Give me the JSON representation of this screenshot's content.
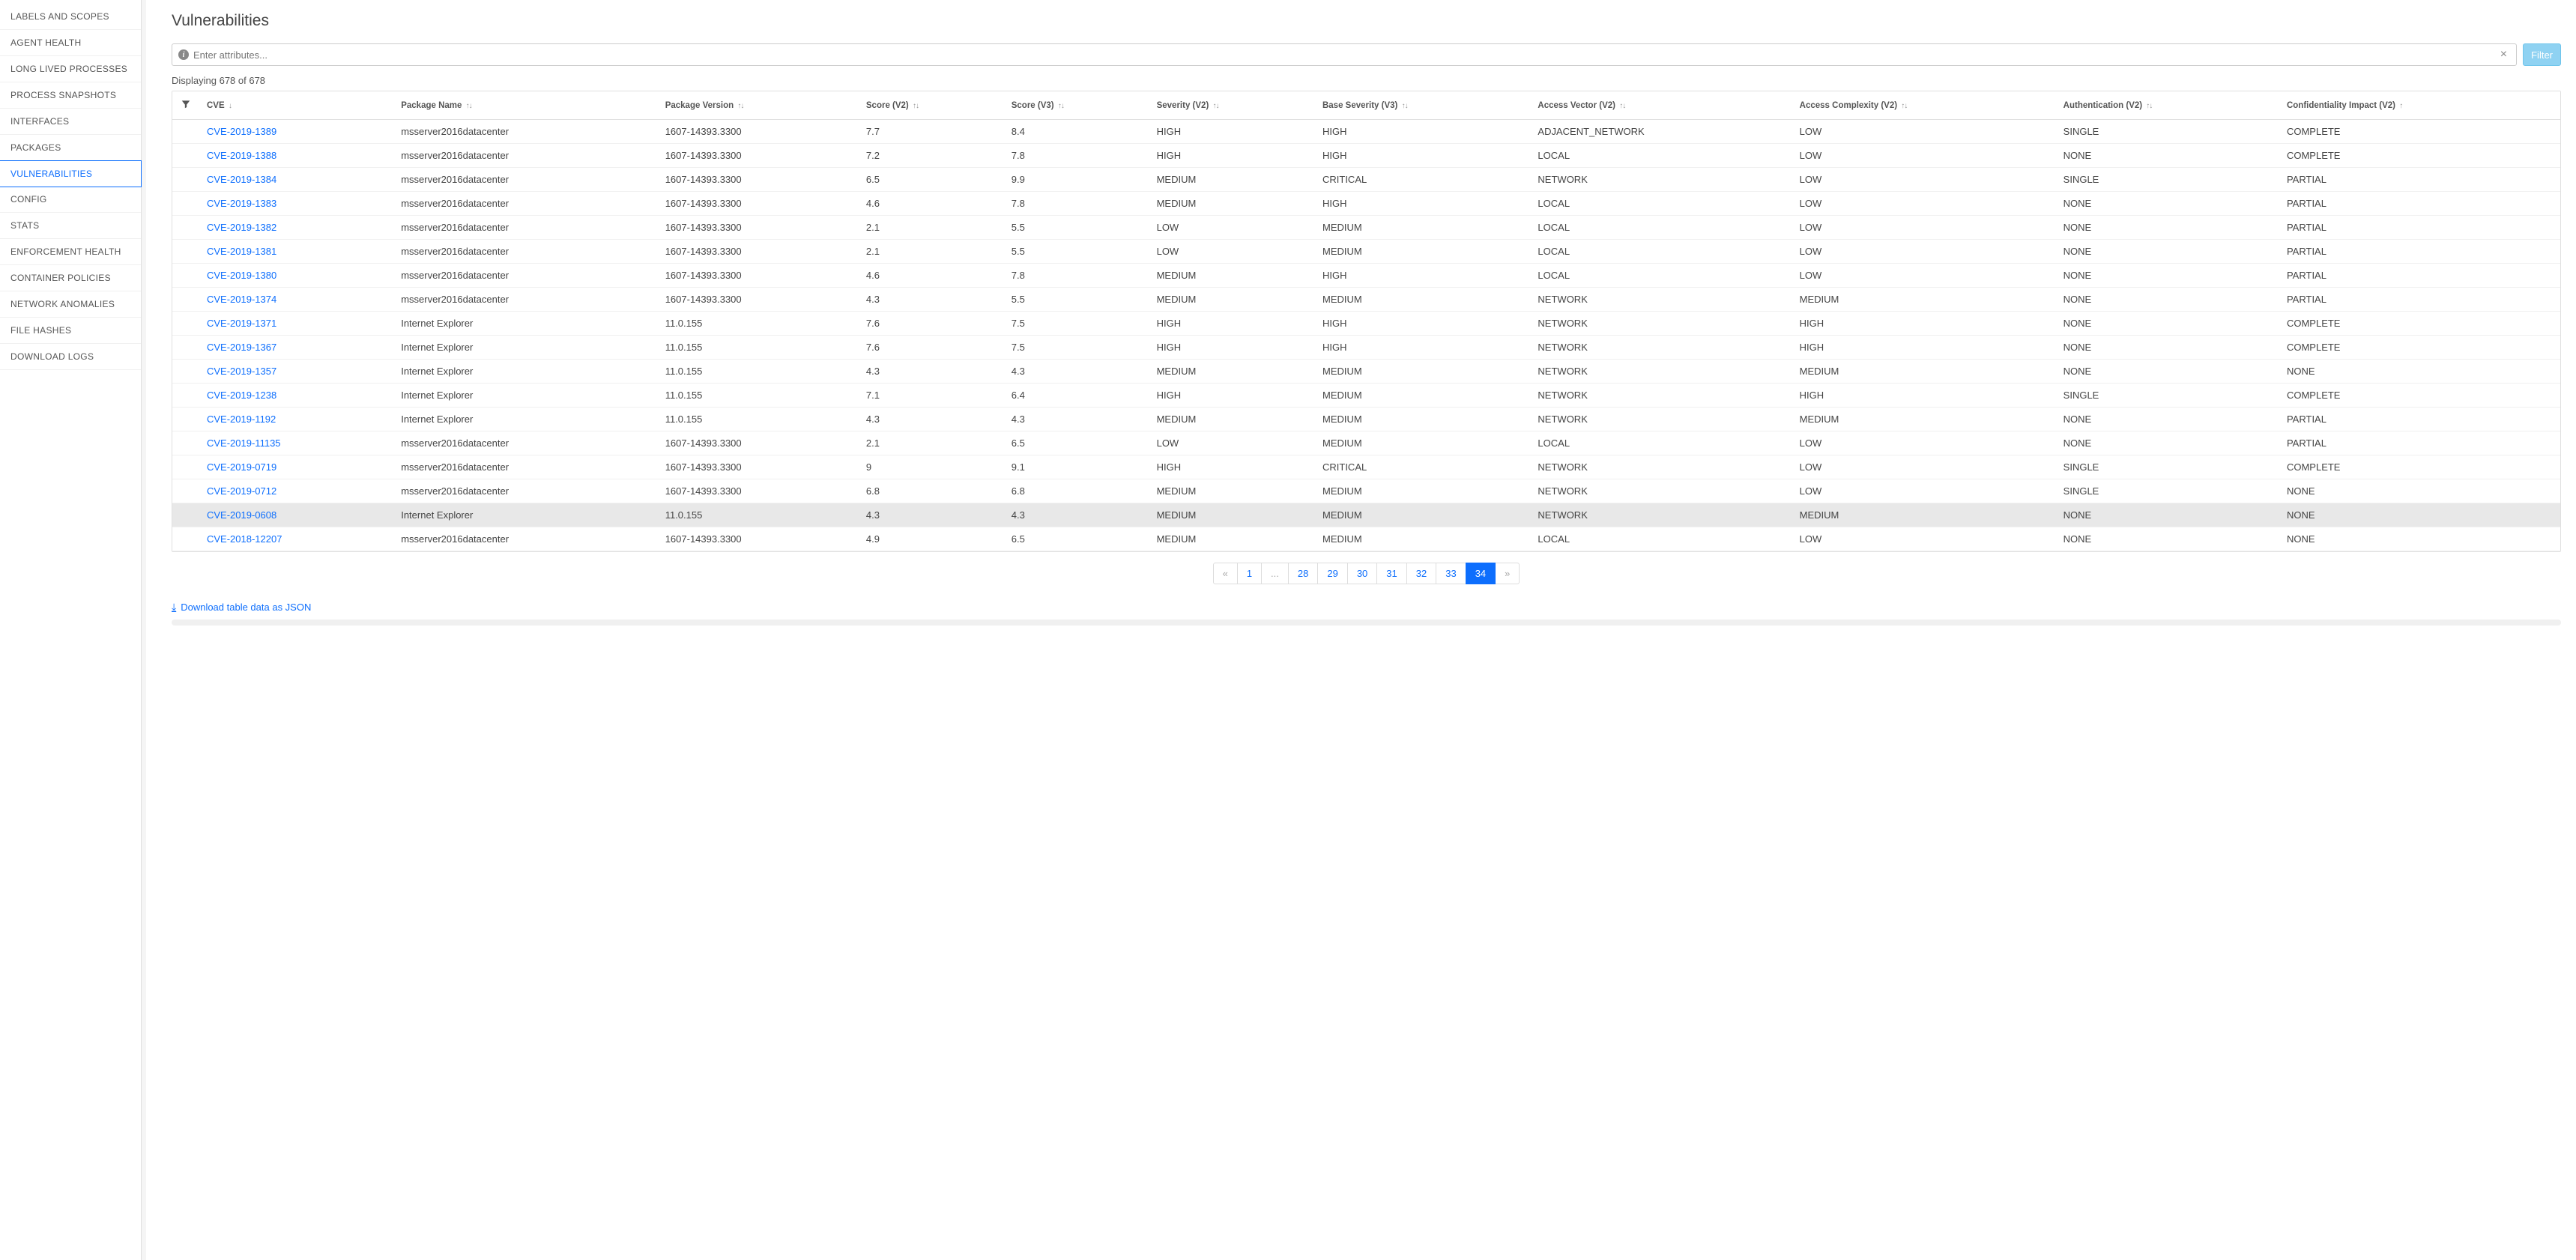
{
  "sidebar": {
    "items": [
      {
        "label": "LABELS AND SCOPES",
        "active": false
      },
      {
        "label": "AGENT HEALTH",
        "active": false
      },
      {
        "label": "LONG LIVED PROCESSES",
        "active": false
      },
      {
        "label": "PROCESS SNAPSHOTS",
        "active": false
      },
      {
        "label": "INTERFACES",
        "active": false
      },
      {
        "label": "PACKAGES",
        "active": false
      },
      {
        "label": "VULNERABILITIES",
        "active": true
      },
      {
        "label": "CONFIG",
        "active": false
      },
      {
        "label": "STATS",
        "active": false
      },
      {
        "label": "ENFORCEMENT HEALTH",
        "active": false
      },
      {
        "label": "CONTAINER POLICIES",
        "active": false
      },
      {
        "label": "NETWORK ANOMALIES",
        "active": false
      },
      {
        "label": "FILE HASHES",
        "active": false
      },
      {
        "label": "DOWNLOAD LOGS",
        "active": false
      }
    ]
  },
  "page": {
    "title": "Vulnerabilities",
    "search_placeholder": "Enter attributes...",
    "filter_button": "Filter",
    "result_count": "Displaying 678 of 678",
    "download_label": "Download table data as JSON"
  },
  "table": {
    "columns": [
      {
        "label": "CVE",
        "sort": "↓"
      },
      {
        "label": "Package Name",
        "sort": "↑↓"
      },
      {
        "label": "Package Version",
        "sort": "↑↓"
      },
      {
        "label": "Score (V2)",
        "sort": "↑↓"
      },
      {
        "label": "Score (V3)",
        "sort": "↑↓"
      },
      {
        "label": "Severity (V2)",
        "sort": "↑↓"
      },
      {
        "label": "Base Severity (V3)",
        "sort": "↑↓"
      },
      {
        "label": "Access Vector (V2)",
        "sort": "↑↓"
      },
      {
        "label": "Access Complexity (V2)",
        "sort": "↑↓"
      },
      {
        "label": "Authentication (V2)",
        "sort": "↑↓"
      },
      {
        "label": "Confidentiality Impact (V2)",
        "sort": "↑"
      }
    ],
    "rows": [
      {
        "cve": "CVE-2019-1389",
        "pkg": "msserver2016datacenter",
        "ver": "1607-14393.3300",
        "s2": "7.7",
        "s3": "8.4",
        "sev2": "HIGH",
        "sev3": "HIGH",
        "av": "ADJACENT_NETWORK",
        "ac": "LOW",
        "auth": "SINGLE",
        "ci": "COMPLETE",
        "hl": false
      },
      {
        "cve": "CVE-2019-1388",
        "pkg": "msserver2016datacenter",
        "ver": "1607-14393.3300",
        "s2": "7.2",
        "s3": "7.8",
        "sev2": "HIGH",
        "sev3": "HIGH",
        "av": "LOCAL",
        "ac": "LOW",
        "auth": "NONE",
        "ci": "COMPLETE",
        "hl": false
      },
      {
        "cve": "CVE-2019-1384",
        "pkg": "msserver2016datacenter",
        "ver": "1607-14393.3300",
        "s2": "6.5",
        "s3": "9.9",
        "sev2": "MEDIUM",
        "sev3": "CRITICAL",
        "av": "NETWORK",
        "ac": "LOW",
        "auth": "SINGLE",
        "ci": "PARTIAL",
        "hl": false
      },
      {
        "cve": "CVE-2019-1383",
        "pkg": "msserver2016datacenter",
        "ver": "1607-14393.3300",
        "s2": "4.6",
        "s3": "7.8",
        "sev2": "MEDIUM",
        "sev3": "HIGH",
        "av": "LOCAL",
        "ac": "LOW",
        "auth": "NONE",
        "ci": "PARTIAL",
        "hl": false
      },
      {
        "cve": "CVE-2019-1382",
        "pkg": "msserver2016datacenter",
        "ver": "1607-14393.3300",
        "s2": "2.1",
        "s3": "5.5",
        "sev2": "LOW",
        "sev3": "MEDIUM",
        "av": "LOCAL",
        "ac": "LOW",
        "auth": "NONE",
        "ci": "PARTIAL",
        "hl": false
      },
      {
        "cve": "CVE-2019-1381",
        "pkg": "msserver2016datacenter",
        "ver": "1607-14393.3300",
        "s2": "2.1",
        "s3": "5.5",
        "sev2": "LOW",
        "sev3": "MEDIUM",
        "av": "LOCAL",
        "ac": "LOW",
        "auth": "NONE",
        "ci": "PARTIAL",
        "hl": false
      },
      {
        "cve": "CVE-2019-1380",
        "pkg": "msserver2016datacenter",
        "ver": "1607-14393.3300",
        "s2": "4.6",
        "s3": "7.8",
        "sev2": "MEDIUM",
        "sev3": "HIGH",
        "av": "LOCAL",
        "ac": "LOW",
        "auth": "NONE",
        "ci": "PARTIAL",
        "hl": false
      },
      {
        "cve": "CVE-2019-1374",
        "pkg": "msserver2016datacenter",
        "ver": "1607-14393.3300",
        "s2": "4.3",
        "s3": "5.5",
        "sev2": "MEDIUM",
        "sev3": "MEDIUM",
        "av": "NETWORK",
        "ac": "MEDIUM",
        "auth": "NONE",
        "ci": "PARTIAL",
        "hl": false
      },
      {
        "cve": "CVE-2019-1371",
        "pkg": "Internet Explorer",
        "ver": "11.0.155",
        "s2": "7.6",
        "s3": "7.5",
        "sev2": "HIGH",
        "sev3": "HIGH",
        "av": "NETWORK",
        "ac": "HIGH",
        "auth": "NONE",
        "ci": "COMPLETE",
        "hl": false
      },
      {
        "cve": "CVE-2019-1367",
        "pkg": "Internet Explorer",
        "ver": "11.0.155",
        "s2": "7.6",
        "s3": "7.5",
        "sev2": "HIGH",
        "sev3": "HIGH",
        "av": "NETWORK",
        "ac": "HIGH",
        "auth": "NONE",
        "ci": "COMPLETE",
        "hl": false
      },
      {
        "cve": "CVE-2019-1357",
        "pkg": "Internet Explorer",
        "ver": "11.0.155",
        "s2": "4.3",
        "s3": "4.3",
        "sev2": "MEDIUM",
        "sev3": "MEDIUM",
        "av": "NETWORK",
        "ac": "MEDIUM",
        "auth": "NONE",
        "ci": "NONE",
        "hl": false
      },
      {
        "cve": "CVE-2019-1238",
        "pkg": "Internet Explorer",
        "ver": "11.0.155",
        "s2": "7.1",
        "s3": "6.4",
        "sev2": "HIGH",
        "sev3": "MEDIUM",
        "av": "NETWORK",
        "ac": "HIGH",
        "auth": "SINGLE",
        "ci": "COMPLETE",
        "hl": false
      },
      {
        "cve": "CVE-2019-1192",
        "pkg": "Internet Explorer",
        "ver": "11.0.155",
        "s2": "4.3",
        "s3": "4.3",
        "sev2": "MEDIUM",
        "sev3": "MEDIUM",
        "av": "NETWORK",
        "ac": "MEDIUM",
        "auth": "NONE",
        "ci": "PARTIAL",
        "hl": false
      },
      {
        "cve": "CVE-2019-11135",
        "pkg": "msserver2016datacenter",
        "ver": "1607-14393.3300",
        "s2": "2.1",
        "s3": "6.5",
        "sev2": "LOW",
        "sev3": "MEDIUM",
        "av": "LOCAL",
        "ac": "LOW",
        "auth": "NONE",
        "ci": "PARTIAL",
        "hl": false
      },
      {
        "cve": "CVE-2019-0719",
        "pkg": "msserver2016datacenter",
        "ver": "1607-14393.3300",
        "s2": "9",
        "s3": "9.1",
        "sev2": "HIGH",
        "sev3": "CRITICAL",
        "av": "NETWORK",
        "ac": "LOW",
        "auth": "SINGLE",
        "ci": "COMPLETE",
        "hl": false
      },
      {
        "cve": "CVE-2019-0712",
        "pkg": "msserver2016datacenter",
        "ver": "1607-14393.3300",
        "s2": "6.8",
        "s3": "6.8",
        "sev2": "MEDIUM",
        "sev3": "MEDIUM",
        "av": "NETWORK",
        "ac": "LOW",
        "auth": "SINGLE",
        "ci": "NONE",
        "hl": false
      },
      {
        "cve": "CVE-2019-0608",
        "pkg": "Internet Explorer",
        "ver": "11.0.155",
        "s2": "4.3",
        "s3": "4.3",
        "sev2": "MEDIUM",
        "sev3": "MEDIUM",
        "av": "NETWORK",
        "ac": "MEDIUM",
        "auth": "NONE",
        "ci": "NONE",
        "hl": true
      },
      {
        "cve": "CVE-2018-12207",
        "pkg": "msserver2016datacenter",
        "ver": "1607-14393.3300",
        "s2": "4.9",
        "s3": "6.5",
        "sev2": "MEDIUM",
        "sev3": "MEDIUM",
        "av": "LOCAL",
        "ac": "LOW",
        "auth": "NONE",
        "ci": "NONE",
        "hl": false
      }
    ]
  },
  "pagination": {
    "items": [
      {
        "label": "«",
        "type": "nav",
        "disabled": true
      },
      {
        "label": "1",
        "type": "page"
      },
      {
        "label": "...",
        "type": "ellipsis",
        "disabled": true
      },
      {
        "label": "28",
        "type": "page"
      },
      {
        "label": "29",
        "type": "page"
      },
      {
        "label": "30",
        "type": "page"
      },
      {
        "label": "31",
        "type": "page"
      },
      {
        "label": "32",
        "type": "page"
      },
      {
        "label": "33",
        "type": "page"
      },
      {
        "label": "34",
        "type": "page",
        "active": true
      },
      {
        "label": "»",
        "type": "nav",
        "disabled": true
      }
    ]
  }
}
